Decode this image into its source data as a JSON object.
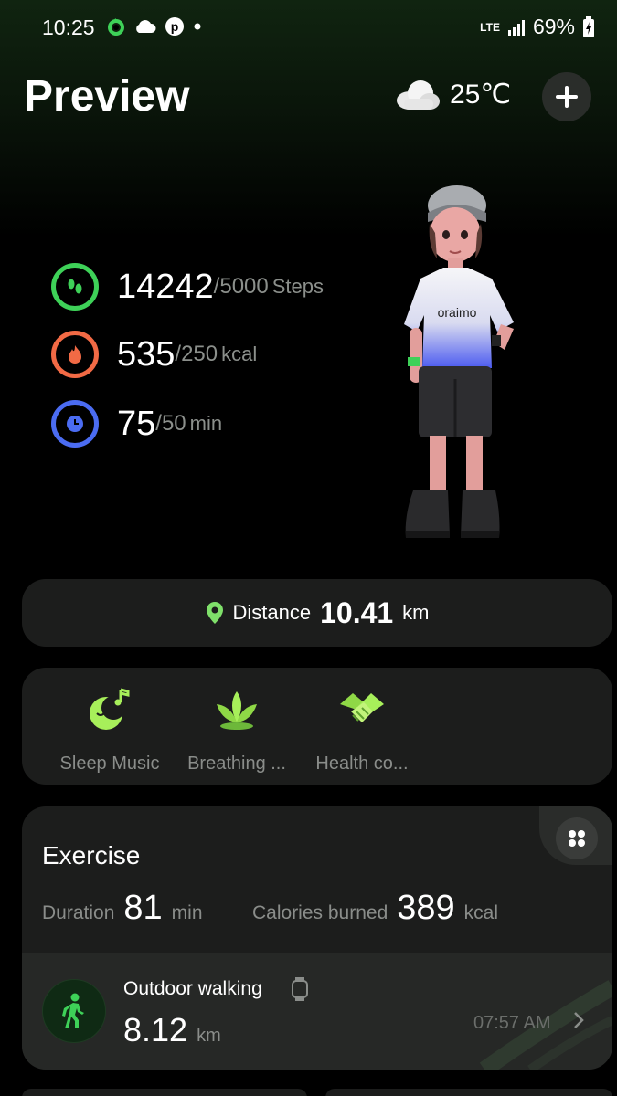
{
  "status_bar": {
    "time": "10:25",
    "network": "LTE",
    "battery": "69%"
  },
  "header": {
    "title": "Preview",
    "weather_temp": "25℃",
    "weather_icon": "cloud-icon",
    "add_icon": "plus-icon"
  },
  "stats": [
    {
      "value": "14242",
      "goal": "/5000",
      "unit": "Steps",
      "color": "#3ed158",
      "icon": "footprints-icon"
    },
    {
      "value": "535",
      "goal": "/250",
      "unit": "kcal",
      "color": "#f26a45",
      "icon": "flame-icon"
    },
    {
      "value": "75",
      "goal": "/50",
      "unit": "min",
      "color": "#4b6cf2",
      "icon": "clock-icon"
    }
  ],
  "avatar": {
    "shirt_text": "oraimo"
  },
  "distance": {
    "label": "Distance",
    "value": "10.41",
    "unit": "km"
  },
  "shortcuts": [
    {
      "label": "Sleep Music",
      "icon": "moon-music-icon"
    },
    {
      "label": "Breathing ...",
      "icon": "lotus-icon"
    },
    {
      "label": "Health co...",
      "icon": "handshake-icon"
    }
  ],
  "exercise": {
    "title": "Exercise",
    "duration_label": "Duration",
    "duration_value": "81",
    "duration_unit": "min",
    "calories_label": "Calories burned",
    "calories_value": "389",
    "calories_unit": "kcal",
    "activity": {
      "name": "Outdoor walking",
      "distance": "8.12",
      "unit": "km",
      "time": "07:57 AM"
    }
  },
  "colors": {
    "accent": "#3ed158",
    "card": "#1c1d1c"
  }
}
